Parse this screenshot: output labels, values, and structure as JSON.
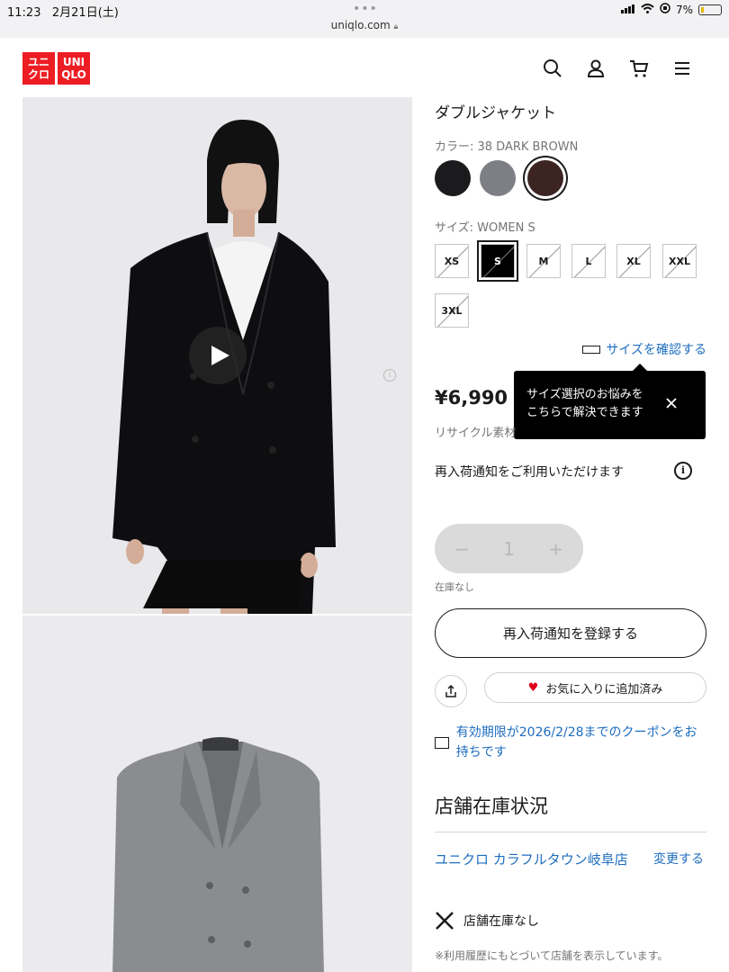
{
  "status_bar": {
    "time": "11:23",
    "date": "2月21日(土)",
    "url": "uniqlo.com",
    "battery": "7%"
  },
  "header": {
    "logo_top": "ユニ",
    "logo_top2": "UNI",
    "logo_bottom": "クロ",
    "logo_bottom2": "QLO",
    "brand_color": "#ed1d24",
    "icons": [
      "search-icon",
      "account-icon",
      "cart-icon",
      "menu-icon"
    ]
  },
  "product": {
    "title": "ダブルジャケット",
    "color_label": "カラー: 38 DARK BROWN",
    "colors": [
      {
        "name": "black",
        "hex": "#1b1b1d"
      },
      {
        "name": "gray",
        "hex": "#7d7f84"
      },
      {
        "name": "dark-brown",
        "hex": "#3b2422",
        "selected": true
      }
    ],
    "size_label": "サイズ: WOMEN S",
    "sizes": [
      "XS",
      "S",
      "M",
      "L",
      "XL",
      "XXL",
      "3XL"
    ],
    "selected_size": "S",
    "size_check_link": "サイズを確認する",
    "tooltip_line1": "サイズ選択のお悩みを",
    "tooltip_line2": "こちらで解決できます",
    "price": "¥6,990",
    "recycle_text": "リサイクル素材",
    "restock_info": "再入荷通知をご利用いただけます",
    "quantity": "1",
    "minus": "−",
    "plus": "+",
    "stock_status": "在庫なし",
    "restock_button": "再入荷通知を登録する",
    "favorite_button": "お気に入りに追加済み",
    "coupon_text": "有効期限が2026/2/28までのクーポンをお持ちです"
  },
  "store": {
    "title": "店舗在庫状況",
    "name": "ユニクロ カラフルタウン岐阜店",
    "change_link": "変更する",
    "stock_text": "店舗在庫なし",
    "note": "※利用履歴にもとづいて店舗を表示しています。"
  }
}
